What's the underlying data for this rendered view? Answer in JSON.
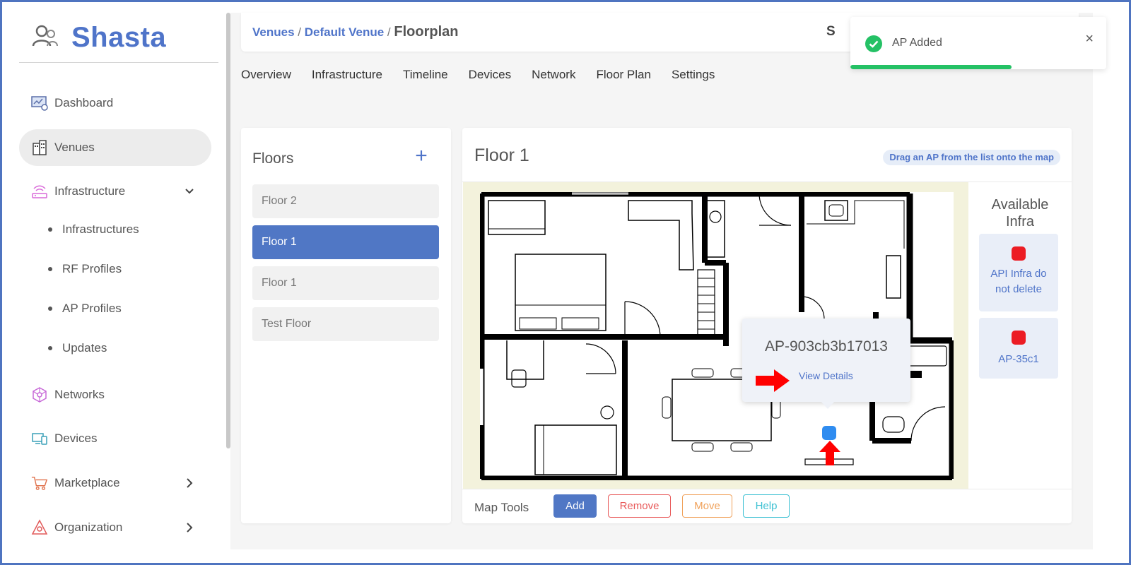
{
  "brand": {
    "name": "Shasta"
  },
  "sidebar": {
    "items": [
      {
        "label": "Dashboard",
        "icon": "dashboard-icon"
      },
      {
        "label": "Venues",
        "icon": "building-icon",
        "active": true
      },
      {
        "label": "Infrastructure",
        "icon": "router-icon",
        "expanded": true
      },
      {
        "label": "Networks",
        "icon": "network-icon"
      },
      {
        "label": "Devices",
        "icon": "devices-icon"
      },
      {
        "label": "Marketplace",
        "icon": "cart-icon"
      },
      {
        "label": "Organization",
        "icon": "organization-icon"
      }
    ],
    "subitems": [
      "Infrastructures",
      "RF Profiles",
      "AP Profiles",
      "Updates"
    ]
  },
  "breadcrumb": {
    "venues": "Venues",
    "venue": "Default Venue",
    "sep": "/",
    "current": "Floorplan",
    "cut_text": "S"
  },
  "tabs": [
    "Overview",
    "Infrastructure",
    "Timeline",
    "Devices",
    "Network",
    "Floor Plan",
    "Settings"
  ],
  "floors": {
    "title": "Floors",
    "add_symbol": "+",
    "items": [
      "Floor 2",
      "Floor 1",
      "Floor 1",
      "Test Floor"
    ],
    "selected_index": 1
  },
  "map": {
    "title": "Floor 1",
    "hint": "Drag an AP from the list onto the map",
    "available_title_1": "Available",
    "available_title_2": "Infra",
    "available": [
      "API Infra do not delete",
      "AP-35c1"
    ],
    "popup": {
      "title": "AP-903cb3b17013",
      "link": "View Details"
    },
    "tools": {
      "label": "Map Tools",
      "add": "Add",
      "remove": "Remove",
      "move": "Move",
      "help": "Help"
    }
  },
  "toast": {
    "message": "AP Added",
    "close": "×",
    "progress": 0.63
  },
  "colors": {
    "accent": "#4f74c9",
    "selected": "#5077c5",
    "success": "#24c165",
    "remove": "#e85a5a",
    "move": "#f0a15a",
    "help": "#3ec1d3",
    "infra_red": "#ec1c24",
    "ap_blue": "#2f8cf0",
    "annotation_red": "#ff0000"
  }
}
